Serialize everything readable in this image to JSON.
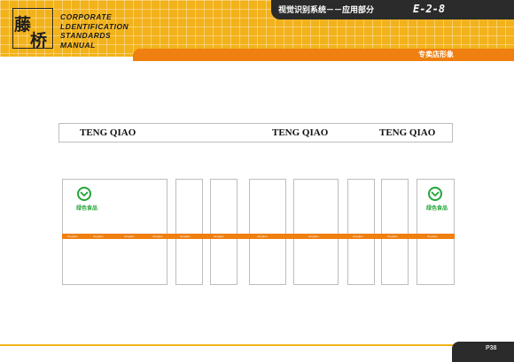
{
  "header": {
    "logo_chars": [
      "藤",
      "桥"
    ],
    "brand_lines": [
      "CORPORATE",
      "LDENTIFICATION",
      "STANDARDS",
      "MANUAL"
    ],
    "title": "视觉识别系统－－应用部分",
    "code": "E-2-8",
    "subtitle": "专卖店形象"
  },
  "signage": {
    "labels": [
      "TENG QIAO",
      "TENG QIAO",
      "TENG QIAO"
    ]
  },
  "storefront": {
    "green_food_label": "绿色食品",
    "stripe_text": "tengqiao"
  },
  "footer": {
    "page": "P38"
  },
  "colors": {
    "header_yellow": "#f2b21b",
    "accent_orange": "#ef7f0f",
    "dark_tab": "#2b2b2b",
    "green_logo": "#24a53a"
  }
}
